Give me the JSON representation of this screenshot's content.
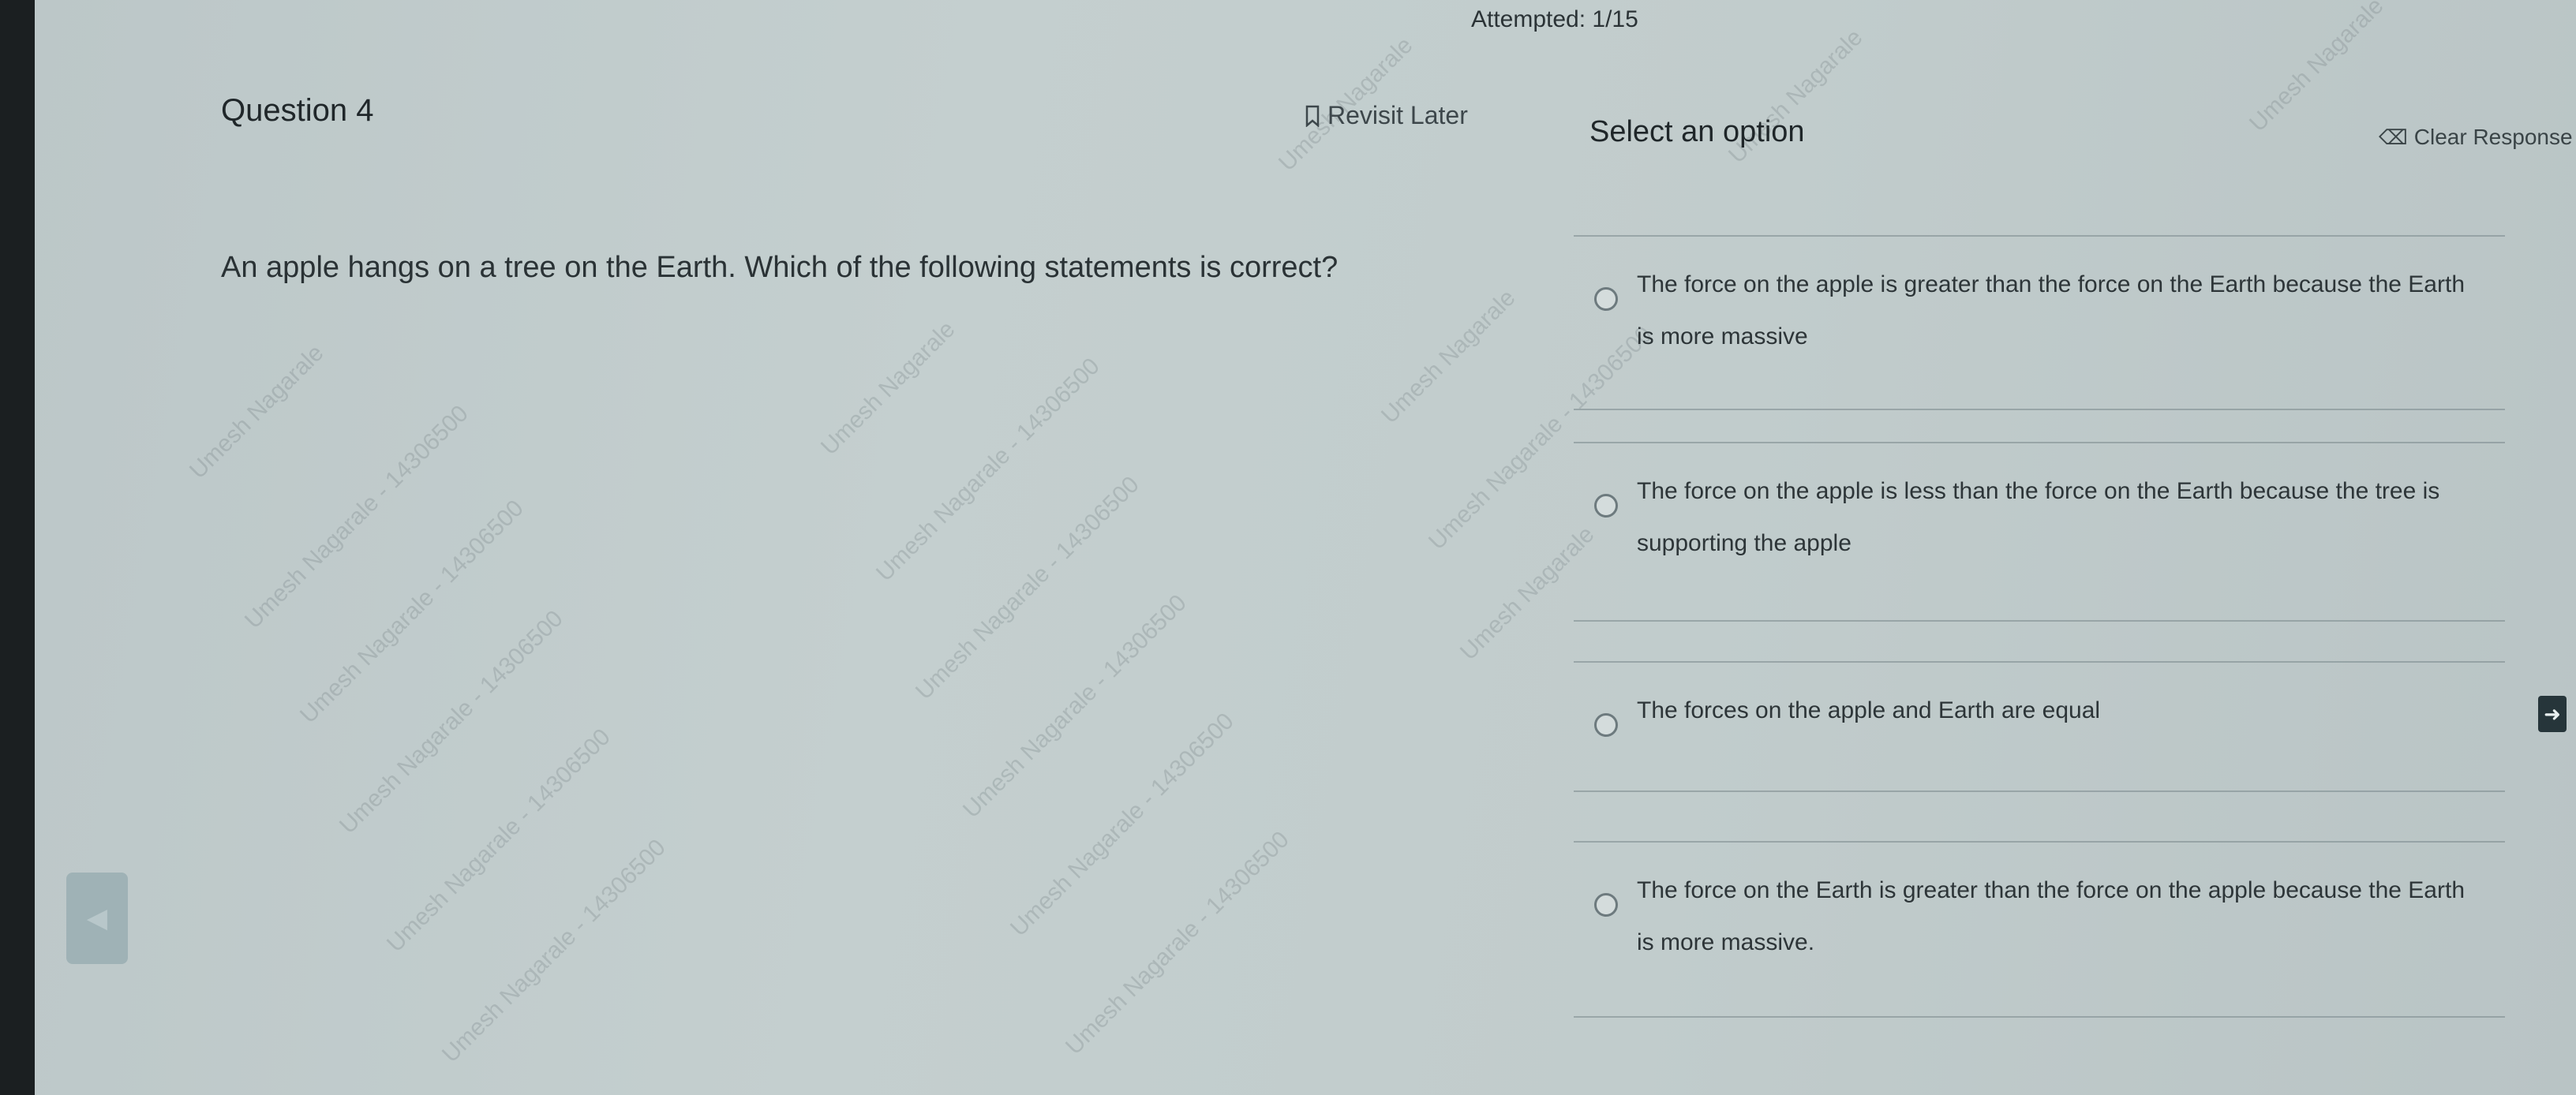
{
  "header": {
    "attempted": "Attempted: 1/15"
  },
  "question": {
    "label": "Question 4",
    "revisit_label": "Revisit Later",
    "text": "An apple hangs on a tree on the Earth. Which of the following statements is correct?"
  },
  "options_panel": {
    "title": "Select an option",
    "clear_label": "Clear Response",
    "options": [
      {
        "text": "The force on the apple is greater than the force on the Earth because the Earth is more massive"
      },
      {
        "text": "The force on the apple is less than the force on the Earth because the tree is supporting the apple"
      },
      {
        "text": "The forces on the apple and Earth are equal"
      },
      {
        "text": "The force on the Earth is greater than the force on the apple because the Earth is more massive."
      }
    ]
  },
  "watermark": {
    "name": "Umesh Nagarale",
    "id": "Umesh Nagarale - 14306500"
  },
  "navigation": {
    "next_icon": "arrow-right-icon",
    "prev_icon": "arrow-left-icon"
  },
  "colors": {
    "background": "#c1cccc",
    "next_button": "#26353a",
    "prev_button": "#9fb2b6"
  }
}
